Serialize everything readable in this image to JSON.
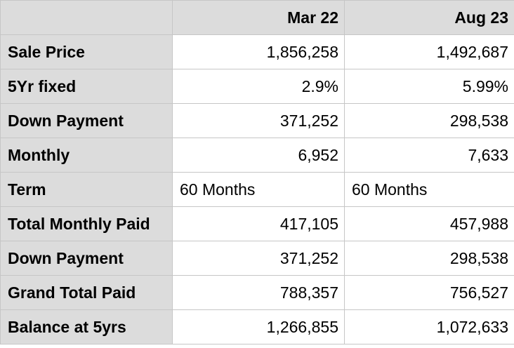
{
  "table": {
    "columns": [
      "",
      "Mar 22",
      "Aug 23"
    ],
    "rows": [
      {
        "label": "Sale Price",
        "values": [
          "1,856,258",
          "1,492,687"
        ]
      },
      {
        "label": "5Yr fixed",
        "values": [
          "2.9%",
          "5.99%"
        ]
      },
      {
        "label": "Down Payment",
        "values": [
          "371,252",
          "298,538"
        ]
      },
      {
        "label": "Monthly",
        "values": [
          "6,952",
          "7,633"
        ]
      },
      {
        "label": "Term",
        "values": [
          "60 Months",
          "60 Months"
        ]
      },
      {
        "label": "Total Monthly Paid",
        "values": [
          "417,105",
          "457,988"
        ]
      },
      {
        "label": "Down Payment",
        "values": [
          "371,252",
          "298,538"
        ]
      },
      {
        "label": "Grand Total Paid",
        "values": [
          "788,357",
          "756,527"
        ]
      },
      {
        "label": "Balance at 5yrs",
        "values": [
          "1,266,855",
          "1,072,633"
        ]
      }
    ]
  }
}
